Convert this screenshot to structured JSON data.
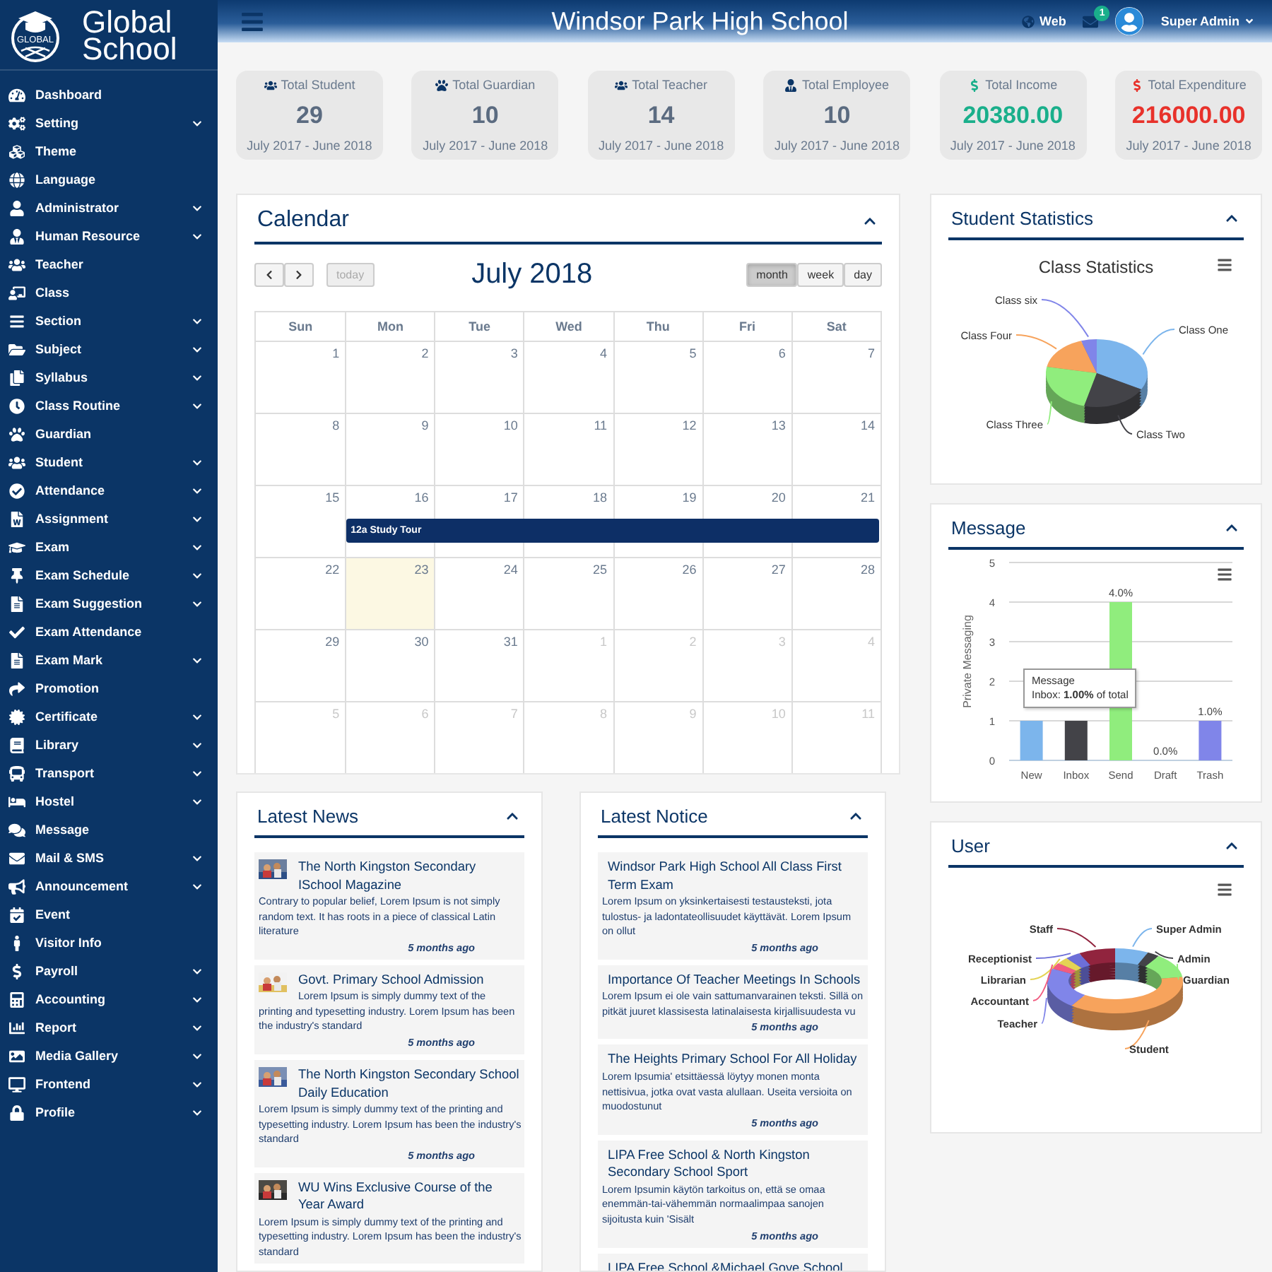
{
  "sidebar": {
    "logo": {
      "emblem_text": "GLOBAL",
      "name_line_1": "Global",
      "name_line_2": "School"
    },
    "items": [
      {
        "label": "Dashboard",
        "expandable": false
      },
      {
        "label": "Setting",
        "expandable": true
      },
      {
        "label": "Theme",
        "expandable": false
      },
      {
        "label": "Language",
        "expandable": false
      },
      {
        "label": "Administrator",
        "expandable": true
      },
      {
        "label": "Human Resource",
        "expandable": true
      },
      {
        "label": "Teacher",
        "expandable": false
      },
      {
        "label": "Class",
        "expandable": false
      },
      {
        "label": "Section",
        "expandable": true
      },
      {
        "label": "Subject",
        "expandable": true
      },
      {
        "label": "Syllabus",
        "expandable": true
      },
      {
        "label": "Class Routine",
        "expandable": true
      },
      {
        "label": "Guardian",
        "expandable": false
      },
      {
        "label": "Student",
        "expandable": true
      },
      {
        "label": "Attendance",
        "expandable": true
      },
      {
        "label": "Assignment",
        "expandable": true
      },
      {
        "label": "Exam",
        "expandable": true
      },
      {
        "label": "Exam Schedule",
        "expandable": true
      },
      {
        "label": "Exam Suggestion",
        "expandable": true
      },
      {
        "label": "Exam Attendance",
        "expandable": false
      },
      {
        "label": "Exam Mark",
        "expandable": true
      },
      {
        "label": "Promotion",
        "expandable": false
      },
      {
        "label": "Certificate",
        "expandable": true
      },
      {
        "label": "Library",
        "expandable": true
      },
      {
        "label": "Transport",
        "expandable": true
      },
      {
        "label": "Hostel",
        "expandable": true
      },
      {
        "label": "Message",
        "expandable": false
      },
      {
        "label": "Mail & SMS",
        "expandable": true
      },
      {
        "label": "Announcement",
        "expandable": true
      },
      {
        "label": "Event",
        "expandable": false
      },
      {
        "label": "Visitor Info",
        "expandable": false
      },
      {
        "label": "Payroll",
        "expandable": true
      },
      {
        "label": "Accounting",
        "expandable": true
      },
      {
        "label": "Report",
        "expandable": true
      },
      {
        "label": "Media Gallery",
        "expandable": true
      },
      {
        "label": "Frontend",
        "expandable": true
      },
      {
        "label": "Profile",
        "expandable": true
      }
    ]
  },
  "header": {
    "title": "Windsor Park High School",
    "web_link": "Web",
    "notification_count": "1",
    "user": "Super Admin"
  },
  "stats": [
    {
      "label": "Total Student",
      "value": "29",
      "period": "July 2017 - June 2018",
      "color": "#5b6b80"
    },
    {
      "label": "Total Guardian",
      "value": "10",
      "period": "July 2017 - June 2018",
      "color": "#5b6b80"
    },
    {
      "label": "Total Teacher",
      "value": "14",
      "period": "July 2017 - June 2018",
      "color": "#5b6b80"
    },
    {
      "label": "Total Employee",
      "value": "10",
      "period": "July 2017 - June 2018",
      "color": "#5b6b80"
    },
    {
      "label": "Total Income",
      "value": "20380.00",
      "period": "July 2017 - June 2018",
      "color": "#1aaf8b"
    },
    {
      "label": "Total Expenditure",
      "value": "216000.00",
      "period": "July 2017 - June 2018",
      "color": "#e8322b"
    }
  ],
  "calendar": {
    "title": "Calendar",
    "month": "July 2018",
    "today_button": {
      "label": "today",
      "disabled": true
    },
    "views": [
      {
        "label": "month",
        "selected": true
      },
      {
        "label": "week",
        "selected": false
      },
      {
        "label": "day",
        "selected": false
      }
    ],
    "weekdays": [
      "Sun",
      "Mon",
      "Tue",
      "Wed",
      "Thu",
      "Fri",
      "Sat"
    ],
    "weeks": [
      {
        "days": [
          {
            "day": "1",
            "other_month": false,
            "today": false
          },
          {
            "day": "2",
            "other_month": false,
            "today": false
          },
          {
            "day": "3",
            "other_month": false,
            "today": false
          },
          {
            "day": "4",
            "other_month": false,
            "today": false
          },
          {
            "day": "5",
            "other_month": false,
            "today": false
          },
          {
            "day": "6",
            "other_month": false,
            "today": false
          },
          {
            "day": "7",
            "other_month": false,
            "today": false
          }
        ]
      },
      {
        "days": [
          {
            "day": "8",
            "other_month": false,
            "today": false
          },
          {
            "day": "9",
            "other_month": false,
            "today": false
          },
          {
            "day": "10",
            "other_month": false,
            "today": false
          },
          {
            "day": "11",
            "other_month": false,
            "today": false
          },
          {
            "day": "12",
            "other_month": false,
            "today": false
          },
          {
            "day": "13",
            "other_month": false,
            "today": false
          },
          {
            "day": "14",
            "other_month": false,
            "today": false
          }
        ]
      },
      {
        "days": [
          {
            "day": "15",
            "other_month": false,
            "today": false
          },
          {
            "day": "16",
            "other_month": false,
            "today": false,
            "event": "12a Study Tour"
          },
          {
            "day": "17",
            "other_month": false,
            "today": false
          },
          {
            "day": "18",
            "other_month": false,
            "today": false
          },
          {
            "day": "19",
            "other_month": false,
            "today": false
          },
          {
            "day": "20",
            "other_month": false,
            "today": false
          },
          {
            "day": "21",
            "other_month": false,
            "today": false
          }
        ]
      },
      {
        "days": [
          {
            "day": "22",
            "other_month": false,
            "today": false
          },
          {
            "day": "23",
            "other_month": false,
            "today": true
          },
          {
            "day": "24",
            "other_month": false,
            "today": false
          },
          {
            "day": "25",
            "other_month": false,
            "today": false
          },
          {
            "day": "26",
            "other_month": false,
            "today": false
          },
          {
            "day": "27",
            "other_month": false,
            "today": false
          },
          {
            "day": "28",
            "other_month": false,
            "today": false
          }
        ]
      },
      {
        "days": [
          {
            "day": "29",
            "other_month": false,
            "today": false
          },
          {
            "day": "30",
            "other_month": false,
            "today": false
          },
          {
            "day": "31",
            "other_month": false,
            "today": false
          },
          {
            "day": "1",
            "other_month": true,
            "today": false
          },
          {
            "day": "2",
            "other_month": true,
            "today": false
          },
          {
            "day": "3",
            "other_month": true,
            "today": false
          },
          {
            "day": "4",
            "other_month": true,
            "today": false
          }
        ]
      },
      {
        "days": [
          {
            "day": "5",
            "other_month": true,
            "today": false
          },
          {
            "day": "6",
            "other_month": true,
            "today": false
          },
          {
            "day": "7",
            "other_month": true,
            "today": false
          },
          {
            "day": "8",
            "other_month": true,
            "today": false
          },
          {
            "day": "9",
            "other_month": true,
            "today": false
          },
          {
            "day": "10",
            "other_month": true,
            "today": false
          },
          {
            "day": "11",
            "other_month": true,
            "today": false
          }
        ]
      }
    ]
  },
  "student_statistics": {
    "title": "Student Statistics",
    "chart_title": "Class Statistics",
    "slices": [
      {
        "label": "Class One",
        "color": "#7cb5ec"
      },
      {
        "label": "Class Two",
        "color": "#434348"
      },
      {
        "label": "Class Three",
        "color": "#90ed7d"
      },
      {
        "label": "Class Four",
        "color": "#f7a35c"
      },
      {
        "label": "Class six",
        "color": "#8085e9"
      }
    ]
  },
  "message": {
    "title": "Message",
    "chart_data": {
      "type": "bar",
      "ylabel": "Private Messaging",
      "categories": [
        "New",
        "Inbox",
        "Send",
        "Draft",
        "Trash"
      ],
      "series": [
        {
          "name": "Message",
          "values": [
            1,
            1,
            4,
            0,
            1
          ]
        }
      ],
      "colors": [
        "#7cb5ec",
        "#434348",
        "#90ed7d",
        "#f7a35c",
        "#8085e9"
      ],
      "ylim": [
        0,
        5
      ],
      "yticks": [
        0,
        1,
        2,
        3,
        4,
        5
      ],
      "grid": true,
      "value_labels": [
        null,
        null,
        "4.0%",
        "0.0%",
        "1.0%"
      ]
    },
    "tooltip": {
      "text": "Inbox: **1.00%** of total"
    }
  },
  "user": {
    "title": "User",
    "segments": [
      {
        "label": "Staff",
        "color": "#91243e"
      },
      {
        "label": "Super Admin",
        "color": "#7cb5ec"
      },
      {
        "label": "Receptionist",
        "color": "#6d6fd8"
      },
      {
        "label": "Admin",
        "color": "#434348"
      },
      {
        "label": "Librarian",
        "color": "#e4d354"
      },
      {
        "label": "Guardian",
        "color": "#90ed7d"
      },
      {
        "label": "Accountant",
        "color": "#f15c80"
      },
      {
        "label": "Teacher",
        "color": "#8085e9"
      },
      {
        "label": "Student",
        "color": "#f7a35c"
      }
    ]
  },
  "latest_news": {
    "title": "Latest News",
    "items": [
      {
        "title": "The North Kingston Secondary ISchool Magazine",
        "body": "Contrary to popular belief, Lorem Ipsum is not simply random text. It has roots in a piece of classical Latin literature",
        "time": "5 months ago"
      },
      {
        "title": "Govt. Primary School Admission",
        "body": "Lorem Ipsum is simply dummy text of the printing and typesetting industry. Lorem Ipsum has been the industry's standard",
        "time": "5 months ago"
      },
      {
        "title": "The North Kingston Secondary School Daily Education",
        "body": "Lorem Ipsum is simply dummy text of the printing and typesetting industry. Lorem Ipsum has been the industry's standard",
        "time": "5 months ago"
      },
      {
        "title": "WU Wins Exclusive Course of the Year Award",
        "body": "Lorem Ipsum is simply dummy text of the printing and typesetting industry. Lorem Ipsum has been the industry's standard"
      }
    ]
  },
  "latest_notice": {
    "title": "Latest Notice",
    "items": [
      {
        "title": "Windsor Park High School All Class First Term Exam",
        "body": "Lorem Ipsum on yksinkertaisesti testausteksti, jota tulostus- ja ladontateollisuudet käyttävät. Lorem Ipsum on ollut",
        "time": "5 months ago"
      },
      {
        "title": "Importance Of Teacher Meetings In Schools",
        "body": "Lorem Ipsum ei ole vain sattumanvarainen teksti. Sillä on pitkät juuret klassisesta latinalaisesta kirjallisuudesta vu",
        "time": "5 months ago"
      },
      {
        "title": "The Heights Primary School For All Holiday",
        "body": "Lorem Ipsumia' etsittäessä löytyy monen monta nettisivua, jotka ovat vasta alullaan. Useita versioita on muodostunut",
        "time": "5 months ago"
      },
      {
        "title": "LIPA Free School & North Kingston Secondary School Sport",
        "body": "Lorem Ipsumin käytön tarkoitus on, että se omaa enemmän-tai-vähemmän normaalimpaa sanojen sijoitusta kuin 'Sisält",
        "time": "5 months ago"
      },
      {
        "title": "LIPA Free School &Michael Gove School"
      }
    ]
  }
}
